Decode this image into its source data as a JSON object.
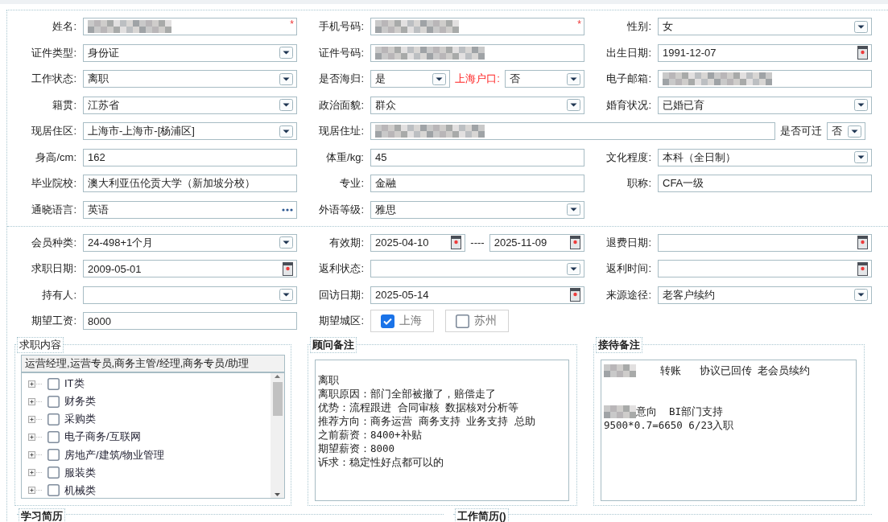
{
  "personal_rows": [
    {
      "cells": [
        {
          "label": "姓名:",
          "fields": [
            {
              "kind": "text",
              "blurred": true,
              "mark": "*"
            }
          ]
        },
        {
          "label": "手机号码:",
          "fields": [
            {
              "kind": "text",
              "blurred": true,
              "mark": "*"
            }
          ]
        },
        {
          "label": "性别:",
          "fields": [
            {
              "kind": "select",
              "value": "女"
            }
          ]
        }
      ]
    },
    {
      "cells": [
        {
          "label": "证件类型:",
          "fields": [
            {
              "kind": "select",
              "value": "身份证"
            }
          ]
        },
        {
          "label": "证件号码:",
          "fields": [
            {
              "kind": "text",
              "blurred": true
            }
          ]
        },
        {
          "label": "出生日期:",
          "fields": [
            {
              "kind": "date",
              "value": "1991-12-07"
            }
          ]
        }
      ]
    },
    {
      "cells": [
        {
          "label": "工作状态:",
          "fields": [
            {
              "kind": "select",
              "value": "离职"
            }
          ]
        },
        {
          "label": "是否海归:",
          "fields": [
            {
              "kind": "select",
              "value": "是"
            },
            {
              "kind": "label",
              "text": "上海户口:",
              "alert": true
            },
            {
              "kind": "select",
              "value": "否"
            }
          ]
        },
        {
          "label": "电子邮箱:",
          "fields": [
            {
              "kind": "text",
              "blurred": true
            }
          ]
        }
      ]
    },
    {
      "cells": [
        {
          "label": "籍贯:",
          "fields": [
            {
              "kind": "select",
              "value": "江苏省"
            }
          ]
        },
        {
          "label": "政治面貌:",
          "fields": [
            {
              "kind": "select",
              "value": "群众"
            }
          ]
        },
        {
          "label": "婚育状况:",
          "fields": [
            {
              "kind": "select",
              "value": "已婚已育"
            }
          ]
        }
      ]
    },
    {
      "cells": [
        {
          "label": "现居住区:",
          "fields": [
            {
              "kind": "select",
              "value": "上海市-上海市-[杨浦区]"
            }
          ]
        },
        {
          "label": "现居住址:",
          "wide": true,
          "fields": [
            {
              "kind": "text",
              "blurred": true
            },
            {
              "kind": "label",
              "text": "是否可迁",
              "alert": false
            },
            {
              "kind": "mini-select",
              "value": "否"
            }
          ]
        }
      ]
    },
    {
      "cells": [
        {
          "label": "身高/cm:",
          "fields": [
            {
              "kind": "text",
              "value": "162"
            }
          ]
        },
        {
          "label": "体重/kg:",
          "fields": [
            {
              "kind": "text",
              "value": "45"
            }
          ]
        },
        {
          "label": "文化程度:",
          "fields": [
            {
              "kind": "select",
              "value": "本科（全日制）"
            }
          ]
        }
      ]
    },
    {
      "cells": [
        {
          "label": "毕业院校:",
          "fields": [
            {
              "kind": "text",
              "value": "澳大利亚伍伦贡大学（新加坡分校）"
            }
          ]
        },
        {
          "label": "专业:",
          "fields": [
            {
              "kind": "text",
              "value": "金融"
            }
          ]
        },
        {
          "label": "职称:",
          "fields": [
            {
              "kind": "text",
              "value": "CFA一级"
            }
          ]
        }
      ]
    },
    {
      "cells": [
        {
          "label": "通晓语言:",
          "fields": [
            {
              "kind": "lookup",
              "value": "英语"
            }
          ]
        },
        {
          "label": "外语等级:",
          "fields": [
            {
              "kind": "select",
              "value": "雅思"
            }
          ]
        }
      ]
    }
  ],
  "membership_rows": [
    {
      "cells": [
        {
          "label": "会员种类:",
          "fields": [
            {
              "kind": "select",
              "value": "24-498+1个月"
            }
          ]
        },
        {
          "label": "有效期:",
          "fields": [
            {
              "kind": "date",
              "value": "2025-04-10"
            },
            {
              "kind": "separator",
              "text": "----"
            },
            {
              "kind": "date",
              "value": "2025-11-09"
            }
          ]
        },
        {
          "label": "退费日期:",
          "fields": [
            {
              "kind": "date"
            }
          ]
        }
      ]
    },
    {
      "cells": [
        {
          "label": "求职日期:",
          "fields": [
            {
              "kind": "date",
              "value": "2009-05-01"
            }
          ]
        },
        {
          "label": "返利状态:",
          "fields": [
            {
              "kind": "select"
            }
          ]
        },
        {
          "label": "返利时间:",
          "fields": [
            {
              "kind": "date"
            }
          ]
        }
      ]
    },
    {
      "cells": [
        {
          "label": "持有人:",
          "fields": [
            {
              "kind": "select"
            }
          ]
        },
        {
          "label": "回访日期:",
          "fields": [
            {
              "kind": "date",
              "value": "2025-05-14"
            }
          ]
        },
        {
          "label": "来源途径:",
          "fields": [
            {
              "kind": "select",
              "value": "老客户续约"
            }
          ]
        }
      ]
    },
    {
      "cells": [
        {
          "label": "期望工资:",
          "fields": [
            {
              "kind": "text",
              "value": "8000"
            }
          ]
        },
        {
          "label": "期望城区:",
          "fields": [
            {
              "kind": "checks",
              "options": [
                {
                  "label": "上海",
                  "checked": true
                },
                {
                  "label": "苏州",
                  "checked": false
                }
              ]
            }
          ]
        }
      ]
    }
  ],
  "job_intent": {
    "legend": "求职内容",
    "summary": "运营经理,运营专员,商务主管/经理,商务专员/助理",
    "categories": [
      {
        "label": "IT类",
        "checked": false
      },
      {
        "label": "财务类",
        "checked": false
      },
      {
        "label": "采购类",
        "checked": false
      },
      {
        "label": "电子商务/互联网",
        "checked": false
      },
      {
        "label": "房地产/建筑/物业管理",
        "checked": false
      },
      {
        "label": "服装类",
        "checked": false
      },
      {
        "label": "机械类",
        "checked": false
      }
    ]
  },
  "advisor_notes": {
    "legend": "顾问备注",
    "lines": [
      {
        "text": "离职"
      },
      {
        "text": "离职原因：部门全部被撤了，赔偿走了"
      },
      {
        "text": "优势：流程跟进 合同审核 数据核对分析等"
      },
      {
        "text": "推荐方向：商务运营 商务支持 业务支持 总助"
      },
      {
        "text": "之前薪资：8400+补贴"
      },
      {
        "text": "期望薪资：8000"
      },
      {
        "text": "诉求：稳定性好点都可以的"
      }
    ]
  },
  "reception_notes": {
    "legend": "接待备注",
    "lines": [
      {
        "blurred_prefix": true,
        "text": "    转账   协议已回传 老会员续约"
      },
      {
        "blurred_prefix": true,
        "spacer_before": true,
        "text": "意向  BI部门支持"
      },
      {
        "text": "9500*0.7=6650 6/23入职"
      }
    ]
  },
  "bottom_sections": [
    {
      "legend": "学习简历"
    },
    {
      "legend": "工作简历()"
    }
  ]
}
